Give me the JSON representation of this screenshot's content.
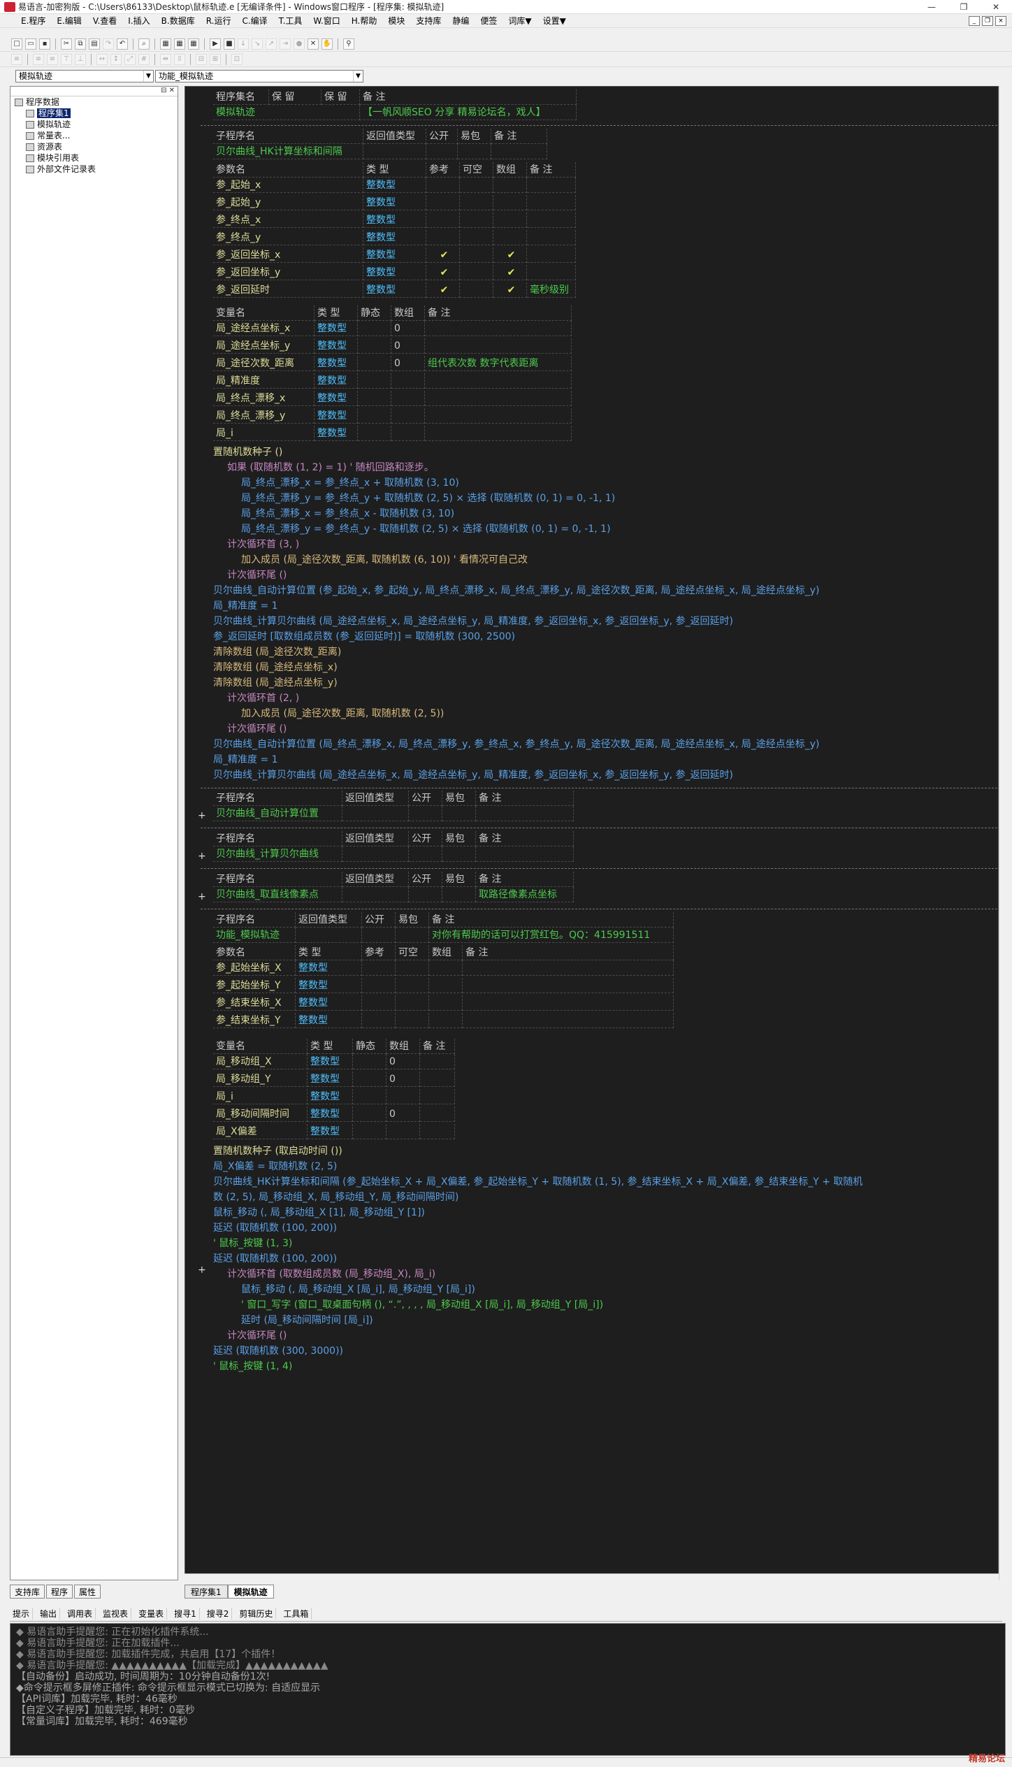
{
  "window": {
    "title": "易语言-加密狗版 - C:\\Users\\86133\\Desktop\\鼠标轨迹.e [无编译条件] - Windows窗口程序 - [程序集: 模拟轨迹]",
    "min": "—",
    "max": "❐",
    "close": "✕"
  },
  "menu": [
    "E.程序",
    "E.编辑",
    "V.查看",
    "I.插入",
    "B.数据库",
    "R.运行",
    "C.编译",
    "T.工具",
    "W.窗口",
    "H.帮助",
    "模块",
    "支持库",
    "静编",
    "便签",
    "词库▼",
    "设置▼"
  ],
  "mdi": [
    "_",
    "❐",
    "×"
  ],
  "combos": {
    "left": "模拟轨迹",
    "right": "功能_模拟轨迹"
  },
  "tree": [
    {
      "label": "程序数据",
      "indent": 0
    },
    {
      "label": "程序集1",
      "indent": 1,
      "sel": true
    },
    {
      "label": "模拟轨迹",
      "indent": 1
    },
    {
      "label": "常量表...",
      "indent": 1
    },
    {
      "label": "资源表",
      "indent": 1
    },
    {
      "label": "模块引用表",
      "indent": 1
    },
    {
      "label": "外部文件记录表",
      "indent": 1
    }
  ],
  "lefttabs": [
    "支持库",
    "程序",
    "属性"
  ],
  "doctabs": [
    "程序集1",
    "模拟轨迹"
  ],
  "outtabs": [
    "提示",
    "输出",
    "调用表",
    "监视表",
    "变量表",
    "搜寻1",
    "搜寻2",
    "剪辑历史",
    "工具箱"
  ],
  "editor": {
    "h_asm": [
      "程序集名",
      "保 留",
      "保 留",
      "备 注"
    ],
    "asm": [
      "模拟轨迹",
      "",
      "",
      "【一帆风顺SEO 分享 精易论坛名，戏人】"
    ],
    "h_sub": [
      "子程序名",
      "返回值类型",
      "公开",
      "易包",
      "备 注"
    ],
    "sub1": "贝尔曲线_HK计算坐标和间隔",
    "h_param": [
      "参数名",
      "类 型",
      "参考",
      "可空",
      "数组",
      "备 注"
    ],
    "params1": [
      [
        "参_起始_x",
        "整数型",
        "",
        "",
        "",
        ""
      ],
      [
        "参_起始_y",
        "整数型",
        "",
        "",
        "",
        ""
      ],
      [
        "参_终点_x",
        "整数型",
        "",
        "",
        "",
        ""
      ],
      [
        "参_终点_y",
        "整数型",
        "",
        "",
        "",
        ""
      ],
      [
        "参_返回坐标_x",
        "整数型",
        "✔",
        "",
        "✔",
        ""
      ],
      [
        "参_返回坐标_y",
        "整数型",
        "✔",
        "",
        "✔",
        ""
      ],
      [
        "参_返回延时",
        "整数型",
        "✔",
        "",
        "✔",
        "毫秒级别"
      ]
    ],
    "h_var": [
      "变量名",
      "类 型",
      "静态",
      "数组",
      "备 注"
    ],
    "vars1": [
      [
        "局_途经点坐标_x",
        "整数型",
        "",
        "0",
        ""
      ],
      [
        "局_途经点坐标_y",
        "整数型",
        "",
        "0",
        ""
      ],
      [
        "局_途径次数_距离",
        "整数型",
        "",
        "0",
        "组代表次数 数字代表距离"
      ],
      [
        "局_精准度",
        "整数型",
        "",
        "",
        ""
      ],
      [
        "局_终点_漂移_x",
        "整数型",
        "",
        "",
        ""
      ],
      [
        "局_终点_漂移_y",
        "整数型",
        "",
        "",
        ""
      ],
      [
        "局_i",
        "整数型",
        "",
        "",
        ""
      ]
    ],
    "code1": [
      "置随机数种子 ()",
      "如果 (取随机数 (1, 2) = 1) ' 随机回路和逐步。",
      "局_终点_漂移_x = 参_终点_x + 取随机数 (3, 10)",
      "局_终点_漂移_y = 参_终点_y + 取随机数 (2, 5) × 选择 (取随机数 (0, 1) = 0, -1, 1)",
      "局_终点_漂移_x = 参_终点_x - 取随机数 (3, 10)",
      "局_终点_漂移_y = 参_终点_y - 取随机数 (2, 5) × 选择 (取随机数 (0, 1) = 0, -1, 1)",
      "计次循环首 (3, )",
      "加入成员 (局_途径次数_距离, 取随机数 (6, 10)) ' 看情况可自己改",
      "计次循环尾 ()",
      "贝尔曲线_自动计算位置 (参_起始_x, 参_起始_y, 局_终点_漂移_x, 局_终点_漂移_y, 局_途径次数_距离, 局_途经点坐标_x, 局_途经点坐标_y)",
      "局_精准度 = 1",
      "贝尔曲线_计算贝尔曲线 (局_途经点坐标_x, 局_途经点坐标_y, 局_精准度, 参_返回坐标_x, 参_返回坐标_y, 参_返回延时)",
      "参_返回延时 [取数组成员数 (参_返回延时)] = 取随机数 (300, 2500)",
      "清除数组 (局_途径次数_距离)",
      "清除数组 (局_途经点坐标_x)",
      "清除数组 (局_途经点坐标_y)",
      "计次循环首 (2, )",
      "加入成员 (局_途径次数_距离, 取随机数 (2, 5))",
      "计次循环尾 ()",
      "贝尔曲线_自动计算位置 (局_终点_漂移_x, 局_终点_漂移_y, 参_终点_x, 参_终点_y, 局_途径次数_距离, 局_途经点坐标_x, 局_途经点坐标_y)",
      "局_精准度 = 1",
      "贝尔曲线_计算贝尔曲线 (局_途经点坐标_x, 局_途经点坐标_y, 局_精准度, 参_返回坐标_x, 参_返回坐标_y, 参_返回延时)"
    ],
    "sub2": [
      "贝尔曲线_自动计算位置",
      ""
    ],
    "sub3": [
      "贝尔曲线_计算贝尔曲线",
      ""
    ],
    "sub4": [
      "贝尔曲线_取直线像素点",
      "取路径像素点坐标"
    ],
    "sub5": [
      "功能_模拟轨迹",
      "对你有帮助的话可以打赏红包。QQ：415991511"
    ],
    "params5": [
      [
        "参_起始坐标_X",
        "整数型"
      ],
      [
        "参_起始坐标_Y",
        "整数型"
      ],
      [
        "参_结束坐标_X",
        "整数型"
      ],
      [
        "参_结束坐标_Y",
        "整数型"
      ]
    ],
    "vars5": [
      [
        "局_移动组_X",
        "整数型",
        "",
        "0"
      ],
      [
        "局_移动组_Y",
        "整数型",
        "",
        "0"
      ],
      [
        "局_i",
        "整数型",
        "",
        ""
      ],
      [
        "局_移动间隔时间",
        "整数型",
        "",
        "0"
      ],
      [
        "局_X偏差",
        "整数型",
        "",
        ""
      ]
    ],
    "code5": [
      "置随机数种子 (取启动时间 ())",
      "局_X偏差 = 取随机数 (2, 5)",
      "贝尔曲线_HK计算坐标和间隔 (参_起始坐标_X + 局_X偏差, 参_起始坐标_Y + 取随机数 (1, 5), 参_结束坐标_X + 局_X偏差, 参_结束坐标_Y + 取随机",
      "数 (2, 5), 局_移动组_X, 局_移动组_Y, 局_移动间隔时间)",
      "鼠标_移动 (, 局_移动组_X [1], 局_移动组_Y [1])",
      "延迟 (取随机数 (100, 200))",
      "' 鼠标_按键 (1, 3)",
      "延迟 (取随机数 (100, 200))",
      "计次循环首 (取数组成员数 (局_移动组_X), 局_i)",
      "鼠标_移动 (, 局_移动组_X [局_i], 局_移动组_Y [局_i])",
      "' 窗口_写字 (窗口_取桌面句柄 (), “.”, , , , 局_移动组_X [局_i], 局_移动组_Y [局_i])",
      "延时 (局_移动间隔时间 [局_i])",
      "计次循环尾 ()",
      "延迟 (取随机数 (300, 3000))",
      "' 鼠标_按键 (1, 4)"
    ]
  },
  "output": [
    "◆ 易语言助手提醒您: 正在初始化插件系统...",
    "◆ 易语言助手提醒您: 正在加载插件...",
    "◆ 易语言助手提醒您: 加载插件完成，共启用【17】个插件！",
    "◆ 易语言助手提醒您: ▲▲▲▲▲▲▲▲▲▲【加载完成】▲▲▲▲▲▲▲▲▲▲▲",
    "【自动备份】启动成功, 时间周期为：10分钟自动备份1次!",
    "◆命令提示框多屏修正插件: 命令提示框显示模式已切换为: 自适应显示",
    "【API词库】加载完毕, 耗时：46毫秒",
    "【自定义子程序】加载完毕, 耗时：0毫秒",
    "【常量词库】加载完毕, 耗时：469毫秒"
  ],
  "watermark": "精易论坛"
}
